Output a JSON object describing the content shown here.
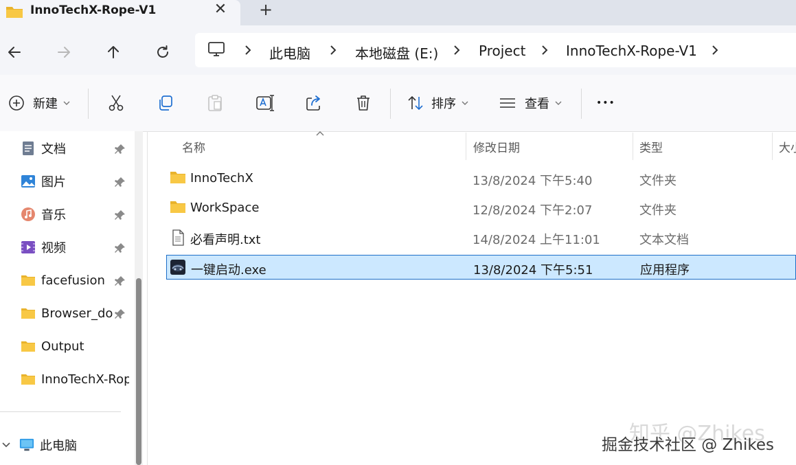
{
  "tab": {
    "title": "InnoTechX-Rope-V1",
    "close_glyph": "✕",
    "new_tab_glyph": "+"
  },
  "breadcrumb": {
    "items": [
      "此电脑",
      "本地磁盘 (E:)",
      "Project",
      "InnoTechX-Rope-V1"
    ]
  },
  "toolbar": {
    "new_label": "新建",
    "sort_label": "排序",
    "view_label": "查看",
    "more_glyph": "•••"
  },
  "sidebar": {
    "items": [
      {
        "label": "文档",
        "icon": "documents-icon",
        "pinned": true
      },
      {
        "label": "图片",
        "icon": "pictures-icon",
        "pinned": true
      },
      {
        "label": "音乐",
        "icon": "music-icon",
        "pinned": true
      },
      {
        "label": "视频",
        "icon": "videos-icon",
        "pinned": true
      },
      {
        "label": "facefusion",
        "icon": "folder-icon",
        "pinned": true
      },
      {
        "label": "Browser_download",
        "icon": "folder-icon",
        "pinned": true
      },
      {
        "label": "Output",
        "icon": "folder-icon",
        "pinned": false
      },
      {
        "label": "InnoTechX-Rope",
        "icon": "folder-icon",
        "pinned": false
      }
    ],
    "this_pc": {
      "label": "此电脑",
      "icon": "this-pc-icon"
    }
  },
  "file_list": {
    "columns": [
      "名称",
      "修改日期",
      "类型",
      "大小"
    ],
    "rows": [
      {
        "name": "InnoTechX",
        "date": "13/8/2024 下午5:40",
        "type": "文件夹",
        "icon": "folder-icon",
        "selected": false
      },
      {
        "name": "WorkSpace",
        "date": "12/8/2024 下午2:07",
        "type": "文件夹",
        "icon": "folder-icon",
        "selected": false
      },
      {
        "name": "必看声明.txt",
        "date": "14/8/2024 上午11:01",
        "type": "文本文档",
        "icon": "text-file-icon",
        "selected": false
      },
      {
        "name": "一键启动.exe",
        "date": "13/8/2024 下午5:51",
        "type": "应用程序",
        "icon": "exe-app-icon",
        "selected": true
      }
    ]
  },
  "watermarks": {
    "top": "知乎 @Zhikes",
    "bottom": "掘金技术社区 @ Zhikes"
  },
  "colors": {
    "selection_bg": "#cce8ff",
    "selection_border": "#1c6ec7",
    "folder": "#f8c845"
  }
}
